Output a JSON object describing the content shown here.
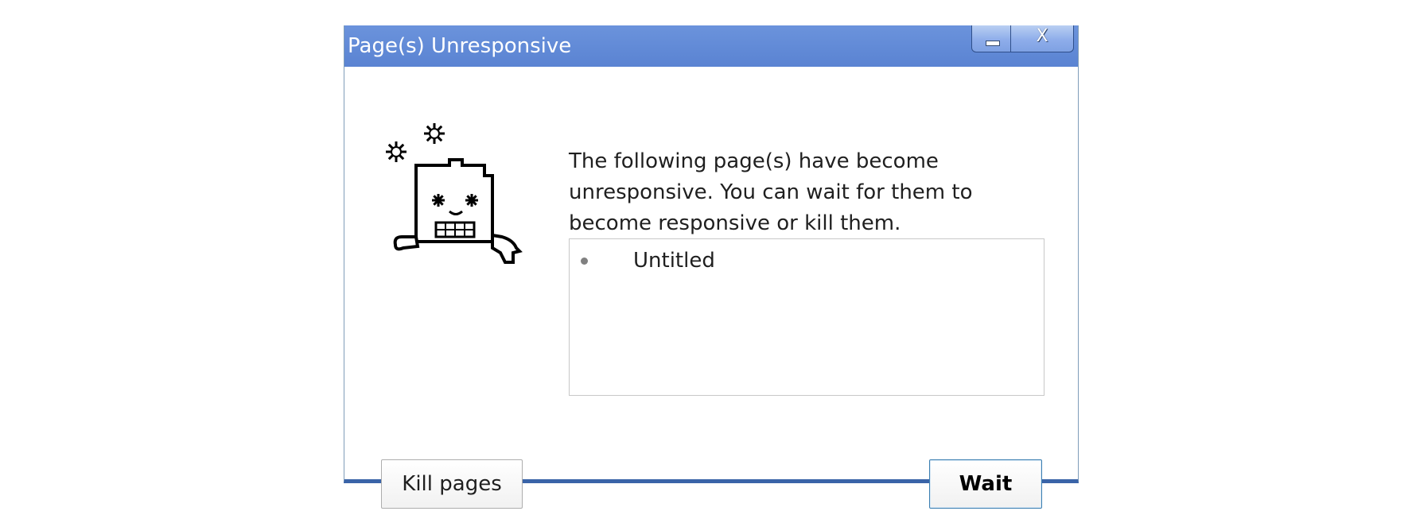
{
  "window": {
    "title": "Page(s) Unresponsive",
    "minimize_glyph": "",
    "close_glyph": "X"
  },
  "illustration": {
    "icon": "frozen-tab-face-icon"
  },
  "message": {
    "text": "The following page(s) have become unresponsive. You can wait for them to become responsive or kill them."
  },
  "pages": [
    {
      "title": "Untitled"
    }
  ],
  "buttons": {
    "kill_label": "Kill pages",
    "wait_label": "Wait"
  },
  "colors": {
    "titlebar": "#5a83d2",
    "window_border": "#3a64a8",
    "default_button_border": "#3c7fb1"
  }
}
